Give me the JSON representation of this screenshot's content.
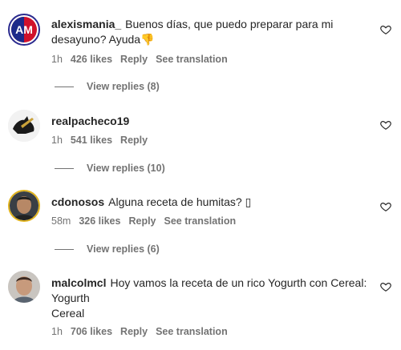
{
  "comments": [
    {
      "username": "alexismania_",
      "text": "Buenos días, que puedo preparar para mi desayuno? Ayuda👎",
      "time": "1h",
      "likes": "426 likes",
      "reply": "Reply",
      "translate": "See translation",
      "view_replies": "View replies (8)"
    },
    {
      "username": "realpacheco19",
      "text": "",
      "time": "1h",
      "likes": "541 likes",
      "reply": "Reply",
      "view_replies": "View replies (10)"
    },
    {
      "username": "cdonosos",
      "text": "Alguna receta de humitas? ▯",
      "time": "58m",
      "likes": "326 likes",
      "reply": "Reply",
      "translate": "See translation",
      "view_replies": "View replies (6)"
    },
    {
      "username": "malcolmcl",
      "text": "Hoy vamos la receta de un rico Yogurth con Cereal:",
      "text_line2": "Yogurth",
      "text_line3": "Cereal",
      "time": "1h",
      "likes": "706 likes",
      "reply": "Reply",
      "translate": "See translation"
    }
  ],
  "colors": {
    "text": "#262626",
    "muted": "#737373"
  },
  "icons": {
    "like": "heart-icon"
  }
}
